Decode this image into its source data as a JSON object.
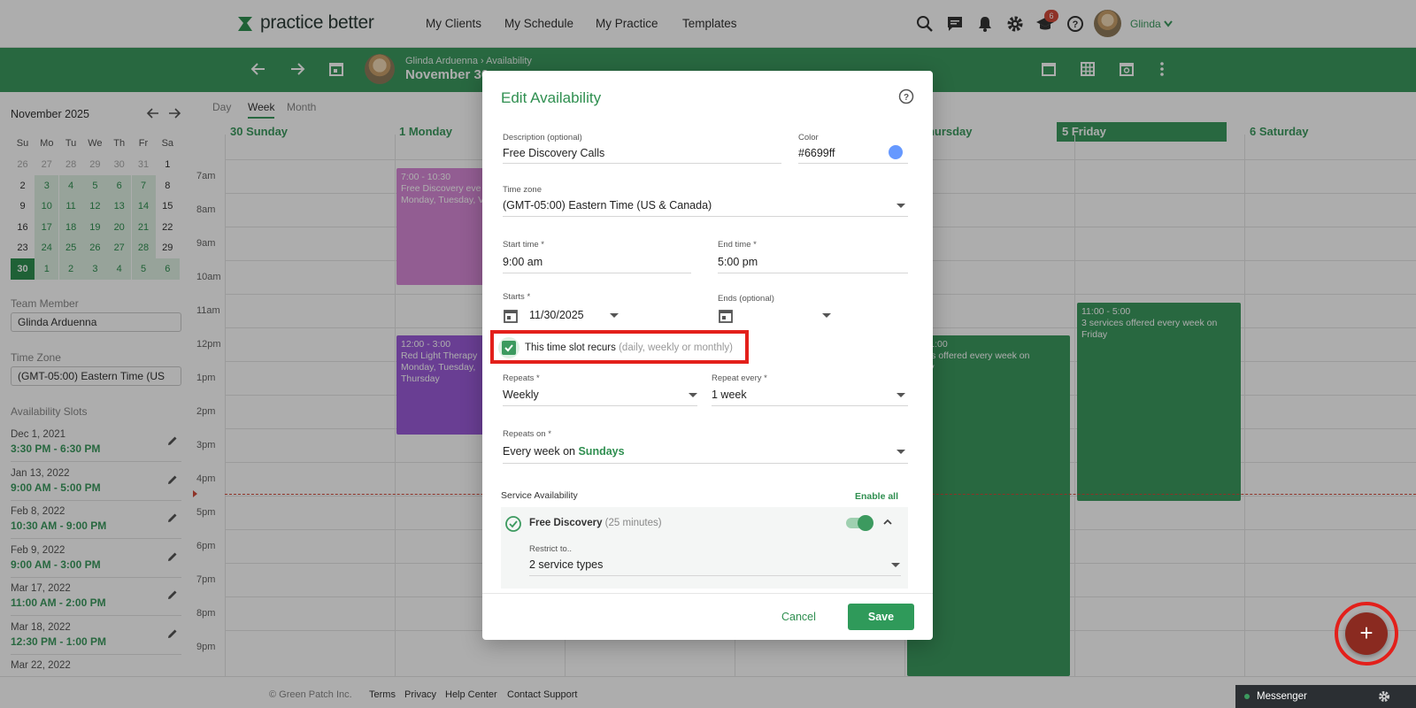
{
  "app": {
    "logo_text": "practice better",
    "nav": [
      "My Clients",
      "My Schedule",
      "My Practice",
      "Templates"
    ],
    "notification_count": "6",
    "user_name": "Glinda"
  },
  "header": {
    "breadcrumb": "Glinda Arduenna › Availability",
    "date_title": "November 30"
  },
  "sidebar": {
    "month_label": "November 2025",
    "weekdays": [
      "Su",
      "Mo",
      "Tu",
      "We",
      "Th",
      "Fr",
      "Sa"
    ],
    "weeks": [
      [
        "26",
        "27",
        "28",
        "29",
        "30",
        "31",
        "1"
      ],
      [
        "2",
        "3",
        "4",
        "5",
        "6",
        "7",
        "8"
      ],
      [
        "9",
        "10",
        "11",
        "12",
        "13",
        "14",
        "15"
      ],
      [
        "16",
        "17",
        "18",
        "19",
        "20",
        "21",
        "22"
      ],
      [
        "23",
        "24",
        "25",
        "26",
        "27",
        "28",
        "29"
      ],
      [
        "30",
        "1",
        "2",
        "3",
        "4",
        "5",
        "6"
      ]
    ],
    "team_member_label": "Team Member",
    "team_member_value": "Glinda Arduenna",
    "time_zone_label": "Time Zone",
    "time_zone_value": "(GMT-05:00) Eastern Time (US",
    "slots_label": "Availability Slots",
    "slots": [
      {
        "date": "Dec 1, 2021",
        "time": "3:30 PM - 6:30 PM"
      },
      {
        "date": "Jan 13, 2022",
        "time": "9:00 AM - 5:00 PM"
      },
      {
        "date": "Feb 8, 2022",
        "time": "10:30 AM - 9:00 PM"
      },
      {
        "date": "Feb 9, 2022",
        "time": "9:00 AM - 3:00 PM"
      },
      {
        "date": "Mar 17, 2022",
        "time": "11:00 AM - 2:00 PM"
      },
      {
        "date": "Mar 18, 2022",
        "time": "12:30 PM - 1:00 PM"
      },
      {
        "date": "Mar 22, 2022",
        "time": ""
      }
    ]
  },
  "calendar": {
    "views": [
      "Day",
      "Week",
      "Month"
    ],
    "active_view": "Week",
    "days": [
      "30 Sunday",
      "1 Monday",
      "",
      "",
      "Thursday",
      "5 Friday",
      "6 Saturday"
    ],
    "hours": [
      "7am",
      "8am",
      "9am",
      "10am",
      "11am",
      "12pm",
      "1pm",
      "2pm",
      "3pm",
      "4pm",
      "5pm",
      "6pm",
      "7pm",
      "8pm",
      "9pm"
    ],
    "events": [
      {
        "time": "7:00 - 10:30",
        "title": "Free Discovery eve",
        "sub": "Monday, Tuesday, V",
        "color": "#d88ad8"
      },
      {
        "time": "12:00 - 3:00",
        "title": "Red Light Therapy",
        "sub": "Monday, Tuesday,",
        "sub2": "Thursday",
        "color": "#9b5cd9"
      },
      {
        "time": "1 - 11:00",
        "title": "rvices offered every week on",
        "sub": "rsday",
        "color": "#3c9a5f"
      },
      {
        "time": "11:00 - 5:00",
        "title": "3 services offered every week on",
        "sub": "Friday",
        "color": "#3c9a5f"
      }
    ]
  },
  "modal": {
    "title": "Edit Availability",
    "description_label": "Description (optional)",
    "description_value": "Free Discovery Calls",
    "color_label": "Color",
    "color_value": "#6699ff",
    "timezone_label": "Time zone",
    "timezone_value": "(GMT-05:00) Eastern Time (US & Canada)",
    "start_time_label": "Start time *",
    "start_time_value": "9:00 am",
    "end_time_label": "End time *",
    "end_time_value": "5:00 pm",
    "starts_label": "Starts *",
    "starts_value": "11/30/2025",
    "ends_label": "Ends (optional)",
    "recurs_label": "This time slot recurs",
    "recurs_hint": "(daily, weekly or monthly)",
    "recurs_checked": true,
    "repeats_label": "Repeats *",
    "repeats_value": "Weekly",
    "repeat_every_label": "Repeat every *",
    "repeat_every_value": "1 week",
    "repeats_on_label": "Repeats on *",
    "repeats_on_prefix": "Every week on",
    "repeats_on_day": "Sundays",
    "service_availability_label": "Service Availability",
    "enable_all": "Enable all",
    "service_name": "Free Discovery",
    "service_duration": "(25 minutes)",
    "restrict_label": "Restrict to..",
    "restrict_value": "2 service types",
    "cancel": "Cancel",
    "save": "Save"
  },
  "footer": {
    "copyright": "© Green Patch Inc.",
    "links": [
      "Terms",
      "Privacy",
      "Help Center",
      "Contact Support"
    ]
  },
  "messenger": "Messenger",
  "colors": {
    "brand_green": "#3c9a5f",
    "highlight_red": "#e3201b"
  }
}
